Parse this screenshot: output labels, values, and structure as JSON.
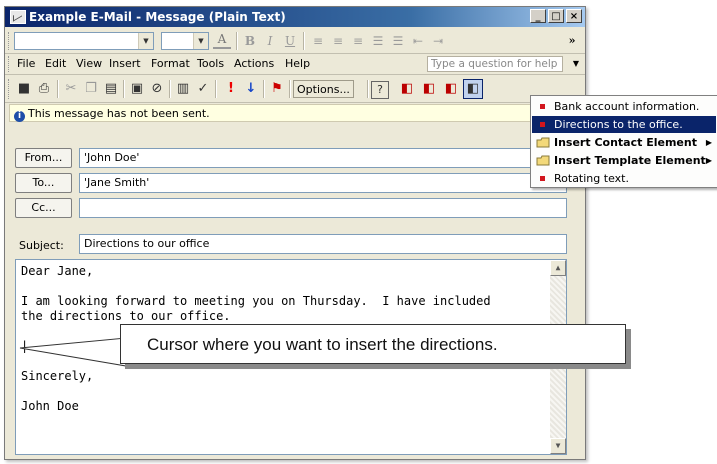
{
  "window": {
    "title": "Example E-Mail - Message (Plain Text)",
    "controls": {
      "minimize": "_",
      "maximize": "□",
      "close": "×"
    }
  },
  "menu": {
    "items": [
      "File",
      "Edit",
      "View",
      "Insert",
      "Format",
      "Tools",
      "Actions",
      "Help"
    ],
    "ask_placeholder": "Type a question for help"
  },
  "toolbar": {
    "options_label": "Options..."
  },
  "info_bar": {
    "text": "This message has not been sent."
  },
  "header": {
    "from_label": "From...",
    "from_value": "'John Doe'",
    "to_label": "To...",
    "to_value": "'Jane Smith'",
    "cc_label": "Cc...",
    "cc_value": "",
    "subject_label": "Subject:",
    "subject_value": "Directions to our office"
  },
  "body": {
    "text": "Dear Jane,\n\nI am looking forward to meeting you on Thursday.  I have included\nthe directions to our office.\n\n|\n\nSincerely,\n\nJohn Doe"
  },
  "callout": {
    "text": "Cursor where you want to insert the directions."
  },
  "context_menu": {
    "items": [
      {
        "label": "Bank account information.",
        "icon": "red-square-icon",
        "selected": false,
        "submenu": false
      },
      {
        "label": "Directions to the office.",
        "icon": "red-square-icon",
        "selected": true,
        "submenu": false
      },
      {
        "label": "Insert Contact Element",
        "icon": "folder-icon",
        "selected": false,
        "submenu": true
      },
      {
        "label": "Insert Template Element",
        "icon": "folder-icon",
        "selected": false,
        "submenu": true
      },
      {
        "label": "Rotating text.",
        "icon": "red-square-icon",
        "selected": false,
        "submenu": false
      }
    ]
  },
  "colors": {
    "title_bar": "#0a246a",
    "menu_selection": "#0a246a",
    "info_bar": "#ffffe1",
    "icon_red": "#d2161e"
  }
}
